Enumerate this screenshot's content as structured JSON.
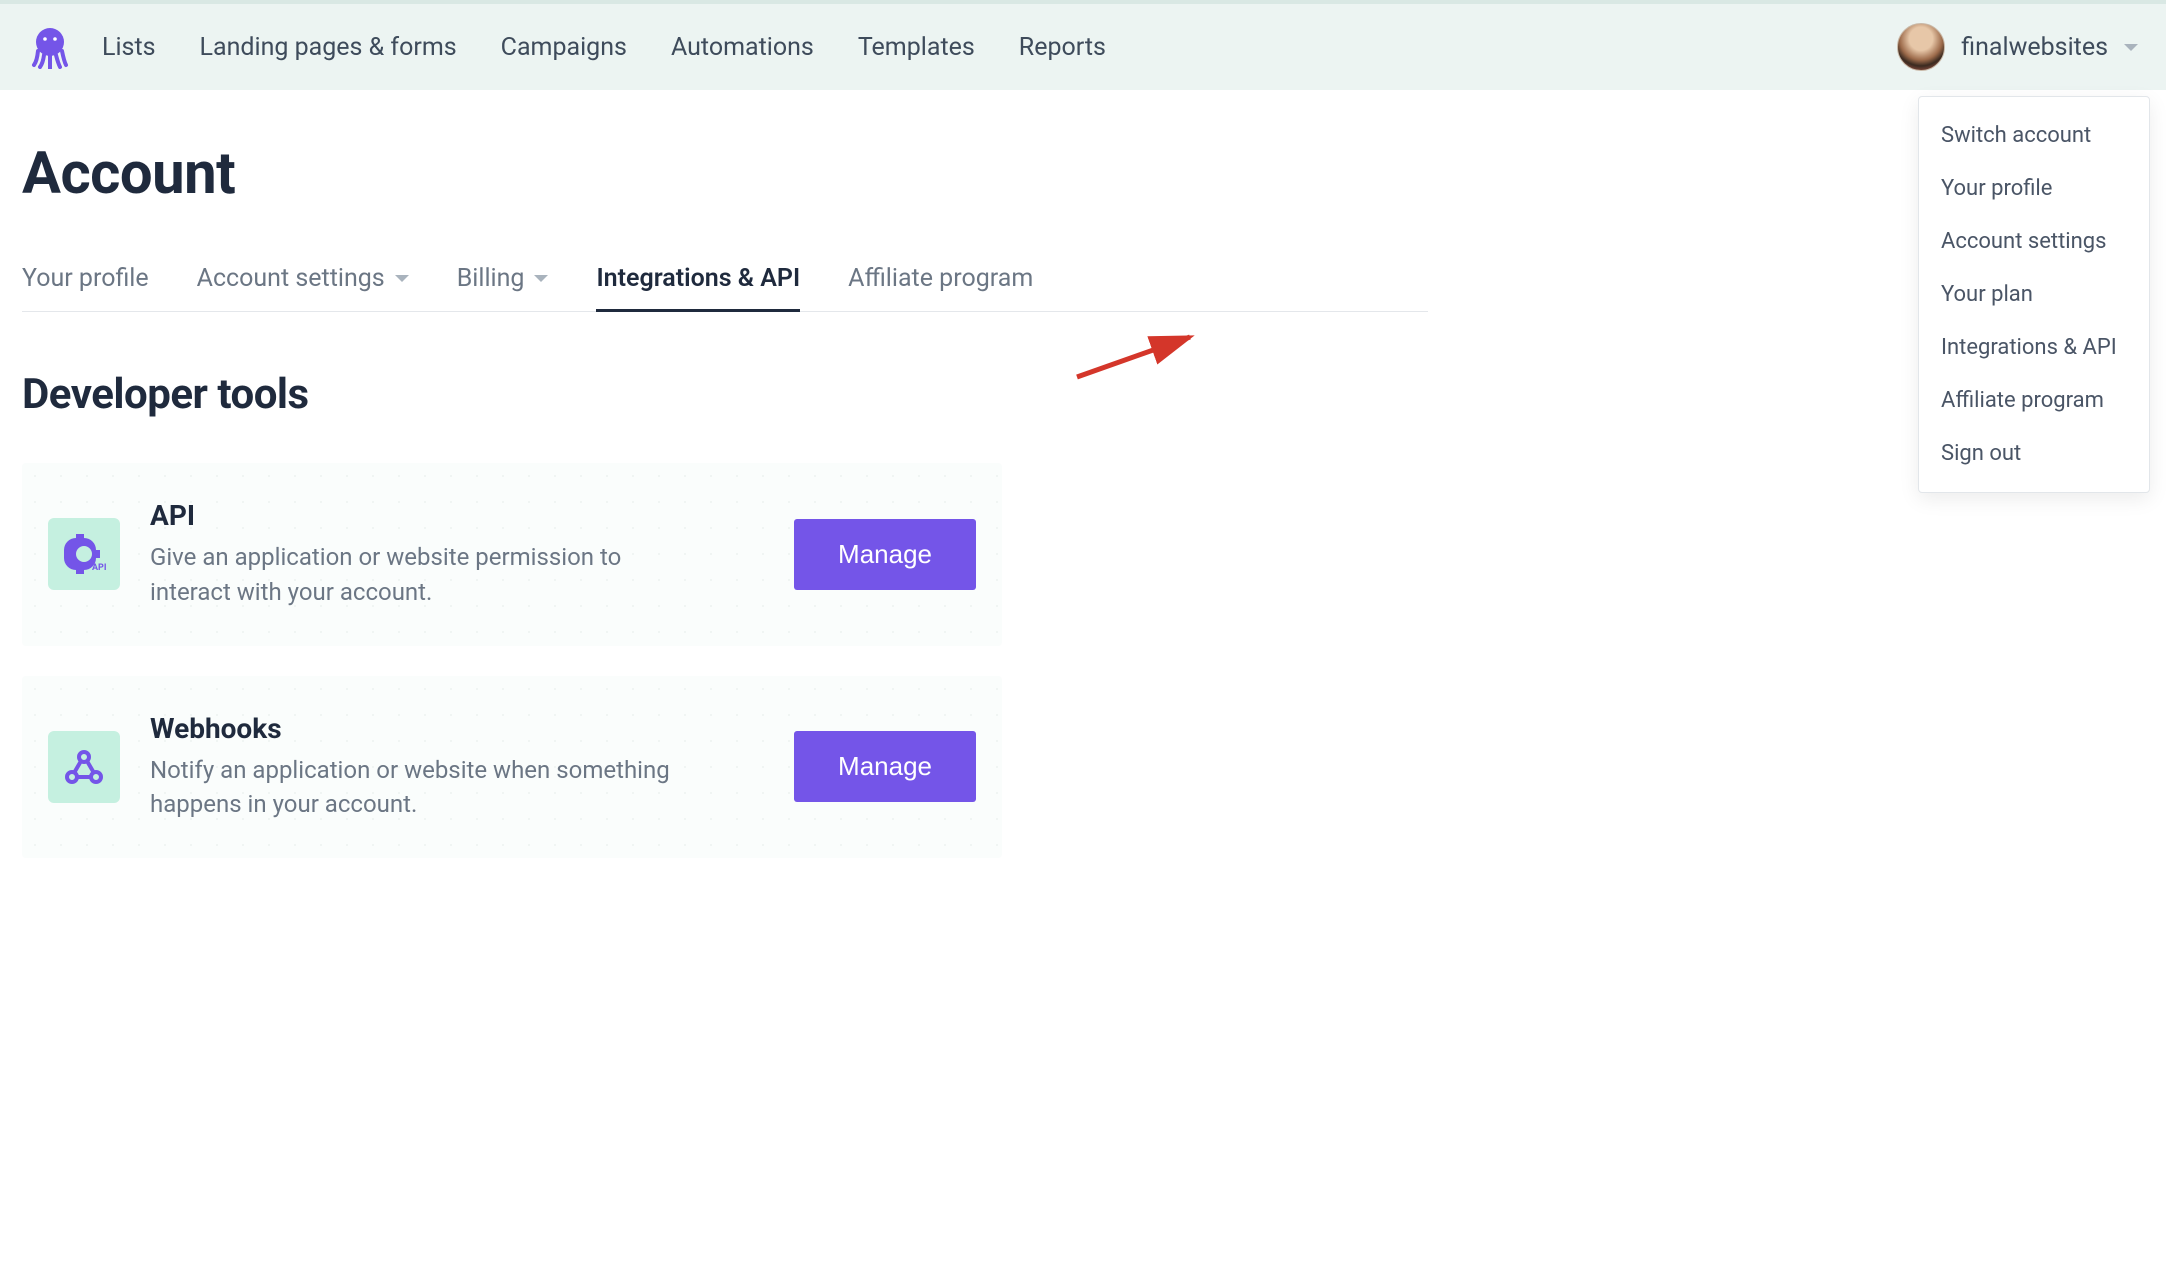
{
  "nav": {
    "items": [
      "Lists",
      "Landing pages & forms",
      "Campaigns",
      "Automations",
      "Templates",
      "Reports"
    ],
    "user": "finalwebsites"
  },
  "dropdown": {
    "items": [
      "Switch account",
      "Your profile",
      "Account settings",
      "Your plan",
      "Integrations & API",
      "Affiliate program",
      "Sign out"
    ]
  },
  "page": {
    "title": "Account",
    "section_title": "Developer tools"
  },
  "subtabs": [
    {
      "label": "Your profile",
      "has_chevron": false,
      "active": false
    },
    {
      "label": "Account settings",
      "has_chevron": true,
      "active": false
    },
    {
      "label": "Billing",
      "has_chevron": true,
      "active": false
    },
    {
      "label": "Integrations & API",
      "has_chevron": false,
      "active": true
    },
    {
      "label": "Affiliate program",
      "has_chevron": false,
      "active": false
    }
  ],
  "cards": [
    {
      "icon": "api",
      "title": "API",
      "desc": "Give an application or website permission to interact with your account.",
      "button": "Manage"
    },
    {
      "icon": "webhooks",
      "title": "Webhooks",
      "desc": "Notify an application or website when something happens in your account.",
      "button": "Manage"
    }
  ],
  "colors": {
    "brand_purple": "#7455e8",
    "nav_bg": "#ecf4f2",
    "card_icon_bg": "#c5f0e0",
    "text_dark": "#1f2a3d",
    "text_muted": "#6b7684"
  }
}
